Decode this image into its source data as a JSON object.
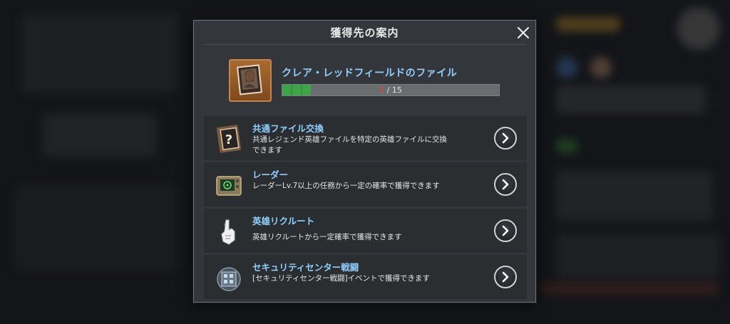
{
  "dialog": {
    "title": "獲得先の案内",
    "close_icon": "close-icon"
  },
  "item": {
    "name": "クレア・レッドフィールドのファイル",
    "icon": "portrait-file-icon",
    "progress": {
      "current": "2",
      "separator": "/",
      "total": "15",
      "fraction": 0.133
    }
  },
  "sources": [
    {
      "title": "共通ファイル交換",
      "description": "共通レジェンド英雄ファイルを特定の英雄ファイルに交換できます",
      "icon": "question-file-icon"
    },
    {
      "title": "レーダー",
      "description": "レーダーLv.7以上の任務から一定の確率で獲得できます",
      "icon": "radar-device-icon"
    },
    {
      "title": "英雄リクルート",
      "description": "英雄リクルートから一定確率で獲得できます",
      "icon": "recruit-hand-icon"
    },
    {
      "title": "セキュリティセンター戦闘",
      "description": "[セキュリティセンター戦闘]イベントで獲得できます",
      "icon": "security-center-icon"
    }
  ],
  "colors": {
    "accent_text": "#8fd0ff",
    "progress_fill": "#3fa34a",
    "progress_current": "#ff3a2e"
  }
}
